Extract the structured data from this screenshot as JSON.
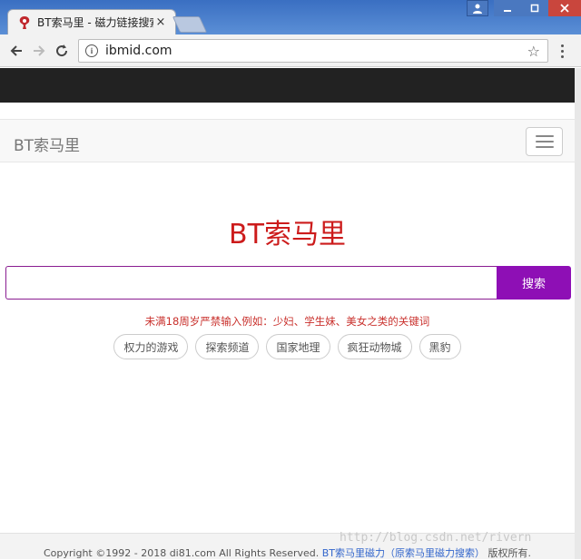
{
  "browser": {
    "tab_title": "BT索马里 - 磁力链接搜索",
    "tab_close": "×",
    "url": "ibmid.com",
    "colors": {
      "titlebar": "#3a6fc2",
      "close": "#c9463d"
    }
  },
  "navbar": {
    "brand": "BT索马里"
  },
  "main": {
    "logo": "BT索马里",
    "search_placeholder": "",
    "search_button": "搜索",
    "warning": "未满18周岁严禁输入例如：少妇、学生妹、美女之类的关键词",
    "tags": [
      "权力的游戏",
      "探索频道",
      "国家地理",
      "疯狂动物城",
      "黑豹"
    ],
    "colors": {
      "logo": "#cc1b1b",
      "button": "#8e0fb5",
      "warning": "#c9302c"
    }
  },
  "footer": {
    "copyright": "Copyright ©1992 - 2018 di81.com All Rights Reserved.",
    "link": "BT索马里磁力（原索马里磁力搜索）",
    "suffix": "版权所有."
  },
  "watermark": "http://blog.csdn.net/rivern"
}
